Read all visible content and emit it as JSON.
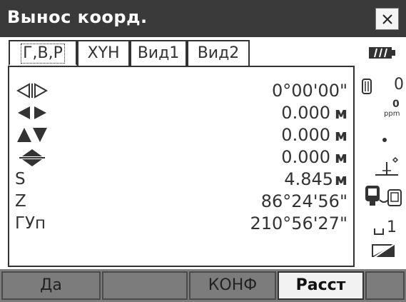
{
  "window": {
    "title": "Вынос коорд.",
    "close_glyph": "×"
  },
  "tabs": [
    {
      "label": "Г,В,Р",
      "active": true
    },
    {
      "label": "XYH",
      "active": false
    },
    {
      "label": "Вид1",
      "active": false
    },
    {
      "label": "Вид2",
      "active": false
    }
  ],
  "rows": [
    {
      "icon": "horizontal-angle-diff-icon",
      "label": "",
      "value": "0°00'00\"",
      "unit": ""
    },
    {
      "icon": "horizontal-distance-diff-icon",
      "label": "",
      "value": "0.000",
      "unit": "м"
    },
    {
      "icon": "height-diff-icon",
      "label": "",
      "value": "0.000",
      "unit": "м"
    },
    {
      "icon": "vertical-diff-icon",
      "label": "",
      "value": "0.000",
      "unit": "м"
    },
    {
      "icon": "",
      "label": "S",
      "value": "4.845",
      "unit": "м"
    },
    {
      "icon": "",
      "label": "Z",
      "value": "86°24'56\"",
      "unit": ""
    },
    {
      "icon": "",
      "label": "ГУп",
      "value": "210°56'27\"",
      "unit": ""
    }
  ],
  "status": {
    "battery_icon": "battery-icon",
    "target_constant": "0",
    "ppm_value": "0",
    "ppm_label": "ppm",
    "laser_icon": "laser-dot-icon",
    "tilt_icon": "tilt-icon",
    "comm_icon": "communication-icon",
    "mode_value": "1",
    "input_mode_icon": "input-mode-icon"
  },
  "softkeys": [
    {
      "label": "Да",
      "highlighted": false
    },
    {
      "label": "",
      "highlighted": false
    },
    {
      "label": "КОНФ",
      "highlighted": false
    },
    {
      "label": "Расст",
      "highlighted": true
    },
    {
      "label": "",
      "highlighted": false
    }
  ],
  "colors": {
    "titlebar": "#3a3a3a",
    "softkey_bar": "#7c7c7c",
    "text": "#333333"
  }
}
